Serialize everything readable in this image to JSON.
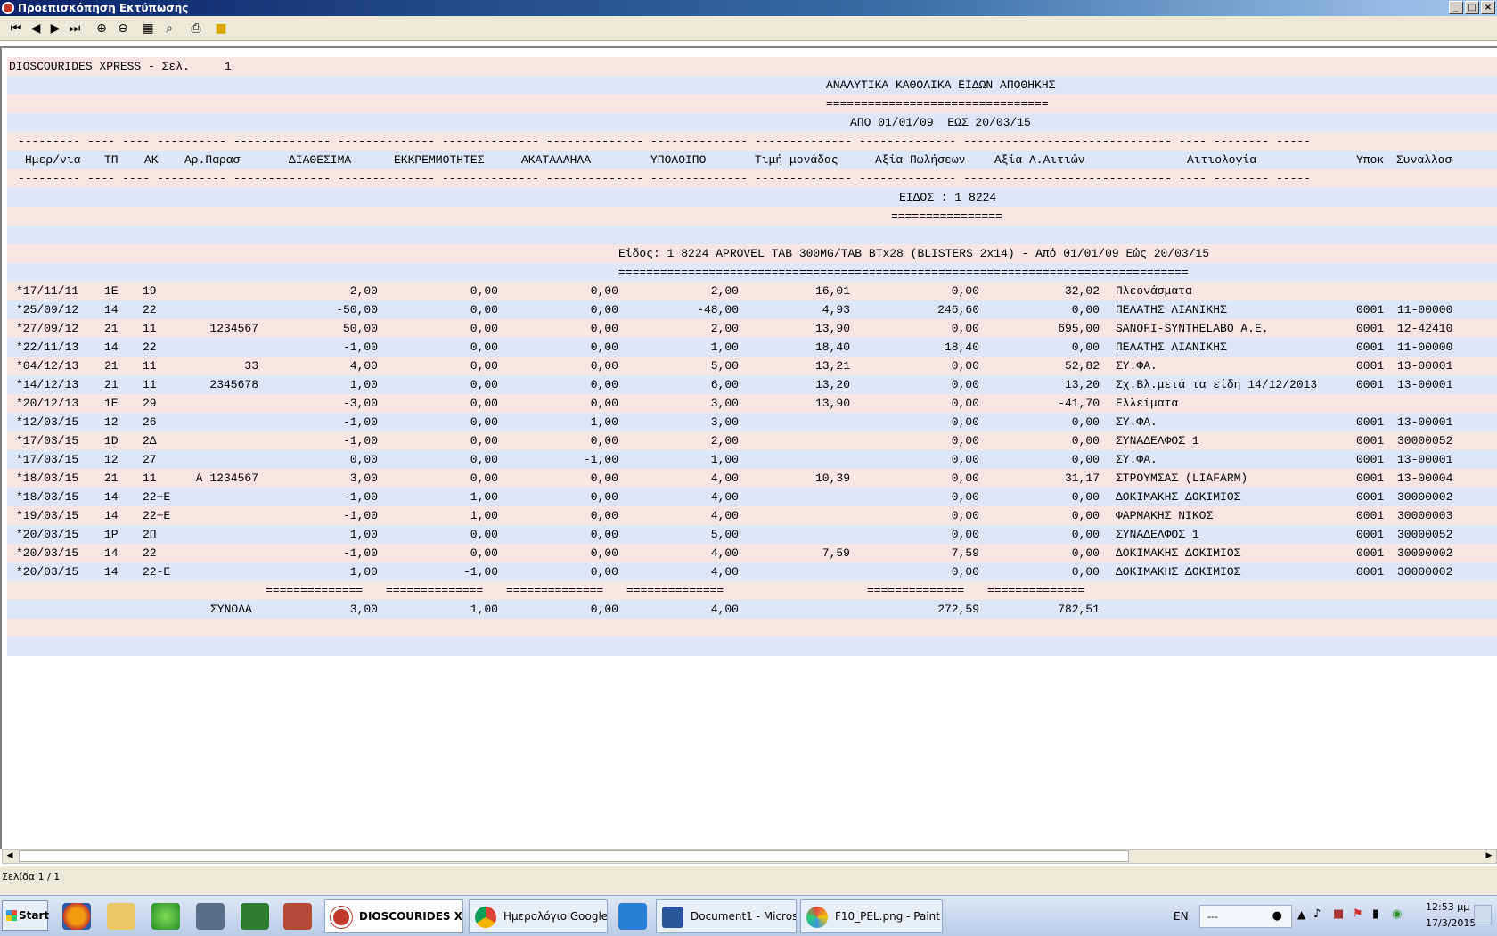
{
  "window": {
    "title": "Προεπισκόπηση Εκτύπωσης"
  },
  "toolbar": {
    "icons": [
      "first-page-icon",
      "prev-page-icon",
      "next-page-icon",
      "last-page-icon",
      "zoom-in-icon",
      "zoom-out-icon",
      "page-setup-icon",
      "find-icon",
      "print-icon",
      "folder-icon"
    ]
  },
  "report": {
    "header_left": "DIOSCOURIDES XPRESS - Σελ.     1",
    "title": "ΑΝΑΛΥΤΙΚΑ ΚΑΘΟΛΙΚΑ ΕΙΔΩΝ ΑΠΟΘΗΚΗΣ",
    "title_underline": "================================",
    "period": "ΑΠΟ 01/01/09  ΕΩΣ 20/03/15",
    "dash_line": "--------- ---- ---- ---------- -------------- -------------- -------------- -------------- -------------- -------------- -------------- ------------------------------ ---- -------- -----",
    "columns": [
      "Ημερ/νια",
      "ΤΠ",
      "ΑΚ",
      "Αρ.Παρασ",
      "ΔΙΑΘΕΣΙΜΑ",
      "ΕΚΚΡΕΜΜΟΤΗΤΕΣ",
      "ΑΚΑΤΑΛΛΗΛΑ",
      "ΥΠΟΛΟΙΠΟ",
      "Τιμή μονάδας",
      "Αξία Πωλήσεων",
      "Αξία Λ.Αιτιών",
      "Αιτιολογία",
      "Υποκ",
      "Συναλλασ"
    ],
    "item_heading": "ΕΙΔΟΣ : 1 8224",
    "item_heading_underline": "================",
    "item_desc": "Είδος: 1 8224 APROVEL TAB 300MG/TAB BTx28 (BLISTERS 2x14) - Από 01/01/09 Εώς 20/03/15",
    "item_desc_underline": "==================================================================================",
    "rows": [
      [
        "*17/11/11",
        "1Ε",
        "19",
        "",
        "2,00",
        "0,00",
        "0,00",
        "2,00",
        "16,01",
        "0,00",
        "32,02",
        "Πλεονάσματα",
        "",
        ""
      ],
      [
        "*25/09/12",
        "14",
        "22",
        "",
        "-50,00",
        "0,00",
        "0,00",
        "-48,00",
        "4,93",
        "246,60",
        "0,00",
        "ΠΕΛΑΤΗΣ ΛΙΑΝΙΚΗΣ",
        "0001",
        "11-00000"
      ],
      [
        "*27/09/12",
        "21",
        "11",
        "1234567",
        "50,00",
        "0,00",
        "0,00",
        "2,00",
        "13,90",
        "0,00",
        "695,00",
        "SANOFI-SYNTHELABO A.E.",
        "0001",
        "12-42410"
      ],
      [
        "*22/11/13",
        "14",
        "22",
        "",
        "-1,00",
        "0,00",
        "0,00",
        "1,00",
        "18,40",
        "18,40",
        "0,00",
        "ΠΕΛΑΤΗΣ ΛΙΑΝΙΚΗΣ",
        "0001",
        "11-00000"
      ],
      [
        "*04/12/13",
        "21",
        "11",
        "33",
        "4,00",
        "0,00",
        "0,00",
        "5,00",
        "13,21",
        "0,00",
        "52,82",
        "ΣΥ.ΦΑ.",
        "0001",
        "13-00001"
      ],
      [
        "*14/12/13",
        "21",
        "11",
        "2345678",
        "1,00",
        "0,00",
        "0,00",
        "6,00",
        "13,20",
        "0,00",
        "13,20",
        "Σχ.Βλ.μετά τα είδη 14/12/2013",
        "0001",
        "13-00001"
      ],
      [
        "*20/12/13",
        "1Ε",
        "29",
        "",
        "-3,00",
        "0,00",
        "0,00",
        "3,00",
        "13,90",
        "0,00",
        "-41,70",
        "Ελλείματα",
        "",
        ""
      ],
      [
        "*12/03/15",
        "12",
        "26",
        "",
        "-1,00",
        "0,00",
        "1,00",
        "3,00",
        "",
        "0,00",
        "0,00",
        "ΣΥ.ΦΑ.",
        "0001",
        "13-00001"
      ],
      [
        "*17/03/15",
        "1D",
        "2Δ",
        "",
        "-1,00",
        "0,00",
        "0,00",
        "2,00",
        "",
        "0,00",
        "0,00",
        "ΣΥΝΑΔΕΛΦΟΣ 1",
        "0001",
        "30000052"
      ],
      [
        "*17/03/15",
        "12",
        "27",
        "",
        "0,00",
        "0,00",
        "-1,00",
        "1,00",
        "",
        "0,00",
        "0,00",
        "ΣΥ.ΦΑ.",
        "0001",
        "13-00001"
      ],
      [
        "*18/03/15",
        "21",
        "11",
        "A 1234567",
        "3,00",
        "0,00",
        "0,00",
        "4,00",
        "10,39",
        "0,00",
        "31,17",
        "ΣΤΡΟΥΜΣΑΣ (LIAFARM)",
        "0001",
        "13-00004"
      ],
      [
        "*18/03/15",
        "14",
        "22+E",
        "",
        "-1,00",
        "1,00",
        "0,00",
        "4,00",
        "",
        "0,00",
        "0,00",
        "ΔΟΚΙΜΑΚΗΣ ΔΟΚΙΜΙΟΣ",
        "0001",
        "30000002"
      ],
      [
        "*19/03/15",
        "14",
        "22+E",
        "",
        "-1,00",
        "1,00",
        "0,00",
        "4,00",
        "",
        "0,00",
        "0,00",
        "ΦΑΡΜΑΚΗΣ ΝΙΚΟΣ",
        "0001",
        "30000003"
      ],
      [
        "*20/03/15",
        "1P",
        "2Π",
        "",
        "1,00",
        "0,00",
        "0,00",
        "5,00",
        "",
        "0,00",
        "0,00",
        "ΣΥΝΑΔΕΛΦΟΣ 1",
        "0001",
        "30000052"
      ],
      [
        "*20/03/15",
        "14",
        "22",
        "",
        "-1,00",
        "0,00",
        "0,00",
        "4,00",
        "7,59",
        "7,59",
        "0,00",
        "ΔΟΚΙΜΑΚΗΣ ΔΟΚΙΜΙΟΣ",
        "0001",
        "30000002"
      ],
      [
        "*20/03/15",
        "14",
        "22-E",
        "",
        "1,00",
        "-1,00",
        "0,00",
        "4,00",
        "",
        "0,00",
        "0,00",
        "ΔΟΚΙΜΑΚΗΣ ΔΟΚΙΜΙΟΣ",
        "0001",
        "30000002"
      ]
    ],
    "totals_rule": "==============",
    "totals_label": "ΣΥΝΟΛΑ",
    "totals": [
      "3,00",
      "1,00",
      "0,00",
      "4,00",
      "272,59",
      "782,51"
    ]
  },
  "status": {
    "page": "Σελίδα 1 / 1"
  },
  "taskbar": {
    "start": "Start",
    "tasks": [
      "DIOSCOURIDES XP...",
      "Ημερολόγιο Google - ...",
      "Document1 - Microsof...",
      "F10_PEL.png - Paint"
    ],
    "lang": "EN",
    "clock_time": "12:53 μμ",
    "clock_date": "17/3/2015",
    "tray_field": "---"
  }
}
